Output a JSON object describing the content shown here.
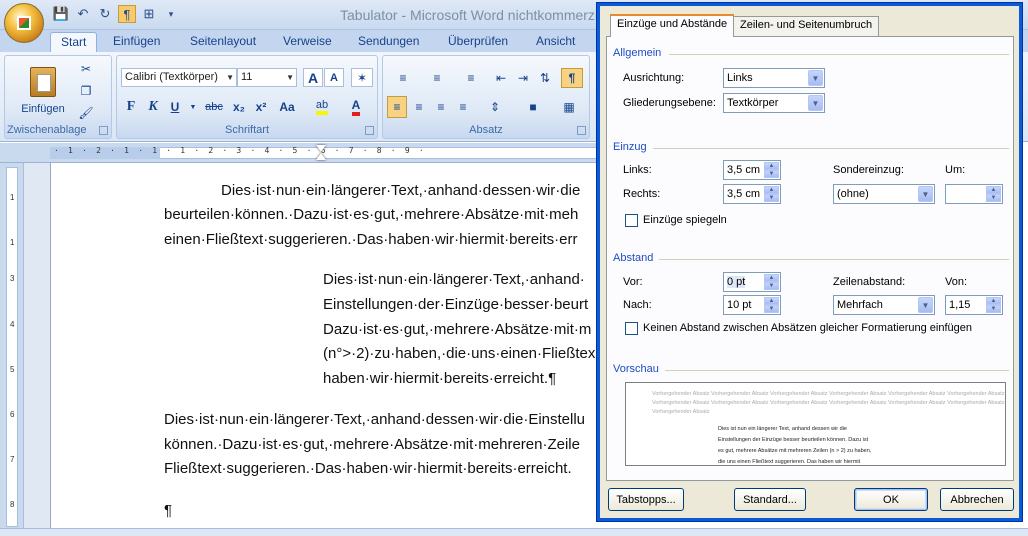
{
  "window": {
    "title": "Tabulator - Microsoft Word nichtkommerzie"
  },
  "ribbon_tabs": [
    "Start",
    "Einfügen",
    "Seitenlayout",
    "Verweise",
    "Sendungen",
    "Überprüfen",
    "Ansicht"
  ],
  "clipboard": {
    "paste_label": "Einfügen",
    "group_label": "Zwischenablage"
  },
  "font": {
    "font_name": "Calibri (Textkörper)",
    "font_size": "11",
    "group_label": "Schriftart",
    "bold": "F",
    "italic": "K",
    "underline": "U",
    "strike": "abc",
    "sub": "x₂",
    "sup": "x²",
    "case": "Aa",
    "grow": "A",
    "shrink": "A"
  },
  "paragraph": {
    "group_label": "Absatz"
  },
  "document": {
    "para1": [
      "Dies·ist·nun·ein·längerer·Text,·anhand·dessen·wir·die",
      "beurteilen·können.·Dazu·ist·es·gut,·mehrere·Absätze·mit·meh",
      "einen·Fließtext·suggerieren.·Das·haben·wir·hiermit·bereits·err"
    ],
    "para2": [
      "Dies·ist·nun·ein·längerer·Text,·anhand·",
      "Einstellungen·der·Einzüge·besser·beurt",
      "Dazu·ist·es·gut,·mehrere·Absätze·mit·m",
      "(n°>·2)·zu·haben,·die·uns·einen·Fließtex",
      "haben·wir·hiermit·bereits·erreicht.¶"
    ],
    "para3": [
      "Dies·ist·nun·ein·längerer·Text,·anhand·dessen·wir·die·Einstellu",
      "können.·Dazu·ist·es·gut,·mehrere·Absätze·mit·mehreren·Zeile",
      "Fließtext·suggerieren.·Das·haben·wir·hiermit·bereits·erreicht."
    ],
    "empty_para": "¶"
  },
  "ruler": {
    "h_marks": "· 1 · 2 · 1 · 1 · 1 · 2 · 3 · 4 · 5 · 6 · 7 · 8 · 9 ·",
    "v_marks": [
      "1",
      "1",
      "2",
      "3",
      "4",
      "5",
      "6",
      "7",
      "8"
    ]
  },
  "dialog": {
    "tabs": [
      "Einzüge und Abstände",
      "Zeilen- und Seitenumbruch"
    ],
    "allgemein": {
      "title": "Allgemein",
      "alignment_label": "Ausrichtung:",
      "alignment_value": "Links",
      "outline_label": "Gliederungsebene:",
      "outline_value": "Textkörper"
    },
    "einzug": {
      "title": "Einzug",
      "left_label": "Links:",
      "left_value": "3,5 cm",
      "right_label": "Rechts:",
      "right_value": "3,5 cm",
      "special_label": "Sondereinzug:",
      "special_value": "(ohne)",
      "by_label": "Um:",
      "by_value": "",
      "mirror_label": "Einzüge spiegeln"
    },
    "abstand": {
      "title": "Abstand",
      "before_label": "Vor:",
      "before_value": "0 pt",
      "after_label": "Nach:",
      "after_value": "10 pt",
      "line_spacing_label": "Zeilenabstand:",
      "line_spacing_value": "Mehrfach",
      "at_label": "Von:",
      "at_value": "1,15",
      "no_space_label": "Keinen Abstand zwischen Absätzen gleicher Formatierung einfügen"
    },
    "vorschau": {
      "title": "Vorschau",
      "gray_lines": [
        "Vorhergehender Absatz Vorhergehender Absatz Vorhergehender Absatz Vorhergehender Absatz Vorhergehender Absatz Vorhergehender Absatz",
        "Vorhergehender Absatz Vorhergehender Absatz Vorhergehender Absatz Vorhergehender Absatz Vorhergehender Absatz Vorhergehender Absatz",
        "Vorhergehender Absatz"
      ],
      "text_lines": [
        "Dies ist nun ein längerer Text, anhand dessen wir die",
        "Einstellungen der Einzüge besser beurteilen können. Dazu ist",
        "es gut, mehrere Absätze mit mehreren Zeilen (n > 2) zu haben,",
        "die uns einen Fließtext suggerieren. Das haben wir hiermit"
      ]
    },
    "buttons": {
      "tabstops": "Tabstopps...",
      "default": "Standard...",
      "ok": "OK",
      "cancel": "Abbrechen"
    }
  },
  "colors": {
    "dialog_border": "#0a5bd8",
    "section_title": "#1c4cc4",
    "ribbon_bg": "#dae6f5",
    "active_toggle": "#f8d283"
  }
}
